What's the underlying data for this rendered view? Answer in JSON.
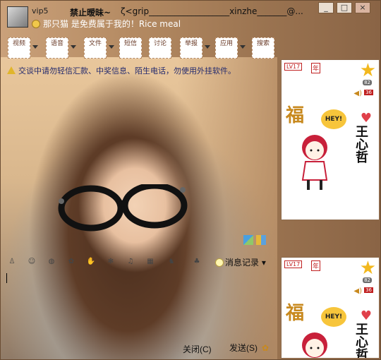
{
  "window": {
    "vip_label": "vip5",
    "nickname": "禁止暧昧~",
    "contact_title": "ζ<grip___________________xinzhe_______@...",
    "status_text": "那只猫  是免费属于我的！Rice meal",
    "controls": {
      "minimize": "_",
      "maximize": "□",
      "close": "×"
    }
  },
  "toolbar": {
    "items": [
      {
        "label": "视频",
        "icon": "video-icon"
      },
      {
        "label": "语音",
        "icon": "voice-icon"
      },
      {
        "label": "文件",
        "icon": "file-icon"
      },
      {
        "label": "短信",
        "icon": "sms-icon"
      },
      {
        "label": "讨论",
        "icon": "discuss-icon"
      },
      {
        "label": "举报",
        "icon": "report-icon"
      },
      {
        "label": "应用",
        "icon": "apps-icon"
      },
      {
        "label": "搜索",
        "icon": "search-icon"
      }
    ]
  },
  "warning": "交谈中请勿轻信汇款、中奖信息、陌生电话，勿使用外挂软件。",
  "side_panel": {
    "level": "LV17",
    "nian": "年",
    "star_count": "82",
    "speaker_count": "36",
    "fu_char": "福",
    "hey_text": "HEY!",
    "name_text": "王心哲"
  },
  "input_toolbar": {
    "history_label": "消息记录"
  },
  "buttons": {
    "close": "关闭(C)",
    "send": "发送(S)"
  },
  "colors": {
    "background": "#b48a62",
    "accent_red": "#c02020",
    "star": "#f2b81e"
  }
}
